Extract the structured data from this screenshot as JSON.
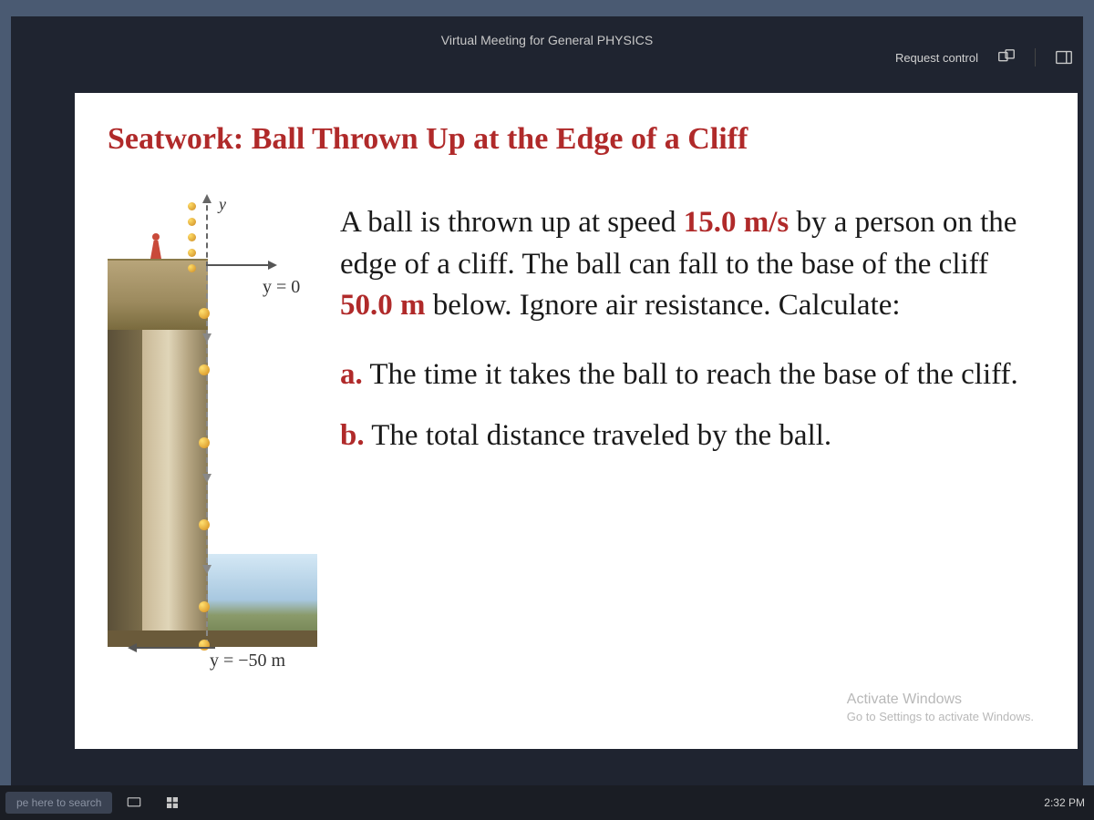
{
  "meeting": {
    "title": "Virtual Meeting for General PHYSICS",
    "request_control": "Request control"
  },
  "slide": {
    "title": "Seatwork: Ball Thrown Up at the Edge of a Cliff",
    "intro_1": "A ball is thrown up at speed ",
    "speed": "15.0 m/s",
    "intro_2": " by a person on the edge of a cliff. The ball can fall to the base of the cliff ",
    "height": "50.0 m",
    "intro_3": " below. Ignore air resistance. Calculate:",
    "qa_letter": "a.",
    "qa_text": " The time it takes the ball to reach the base of the cliff.",
    "qb_letter": "b.",
    "qb_text": " The total distance traveled by the ball.",
    "diagram": {
      "y_axis": "y",
      "y0": "y = 0",
      "y50": "y = −50 m"
    }
  },
  "watermark": {
    "line1": "Activate Windows",
    "line2": "Go to Settings to activate Windows."
  },
  "taskbar": {
    "search": "pe here to search",
    "time": "2:32 PM"
  }
}
